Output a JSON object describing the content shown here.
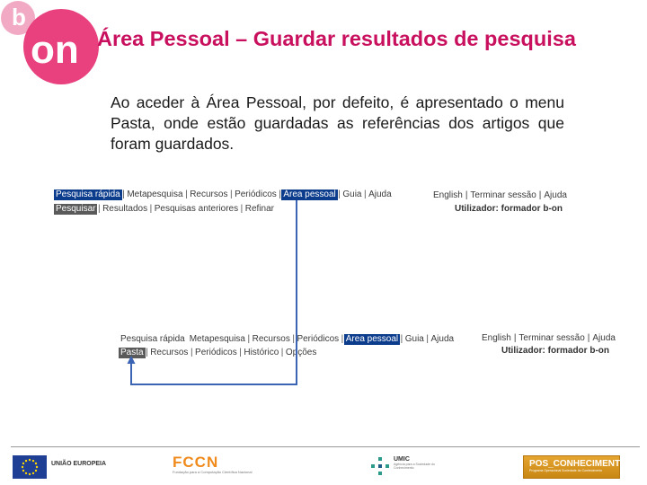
{
  "slide": {
    "title": "Área Pessoal – Guardar resultados de pesquisa",
    "body": "Ao aceder à Área Pessoal, por defeito, é apresentado o menu Pasta, onde estão guardadas as referências dos artigos que foram guardados."
  },
  "logo": {
    "letter_b": "b",
    "letters_on": "on"
  },
  "screen1": {
    "nav": [
      "Pesquisa rápida",
      "Metapesquisa",
      "Recursos",
      "Periódicos",
      "Área pessoal",
      "Guia",
      "Ajuda"
    ],
    "subnav": [
      "Pesquisar",
      "Resultados",
      "Pesquisas anteriores",
      "Refinar"
    ],
    "links": [
      "English",
      "Terminar sessão",
      "Ajuda"
    ],
    "user": "Utilizador: formador b-on"
  },
  "screen2": {
    "nav": [
      "Pesquisa rápida",
      "Metapesquisa",
      "Recursos",
      "Periódicos",
      "Área pessoal",
      "Guia",
      "Ajuda"
    ],
    "subnav": [
      "Pasta",
      "Recursos",
      "Periódicos",
      "Histórico",
      "Opções"
    ],
    "links": [
      "English",
      "Terminar sessão",
      "Ajuda"
    ],
    "user": "Utilizador: formador b-on"
  },
  "footer": {
    "eu": "UNIÃO EUROPEIA",
    "fccn": "FCCN",
    "fccn_sub": "Fundação para a Computação Científica Nacional",
    "umic": "UMIC",
    "umic_sub": "Agência para a Sociedade do Conhecimento",
    "pos": "POS_CONHECIMENTO",
    "pos_sub": "Programa Operacional Sociedade do Conhecimento"
  },
  "colors": {
    "title": "#c8105f",
    "logo": "#e8417e",
    "nav_active": "#0c3c8c",
    "subnav_active": "#5a5a5a",
    "arrow": "#3c64b4"
  }
}
